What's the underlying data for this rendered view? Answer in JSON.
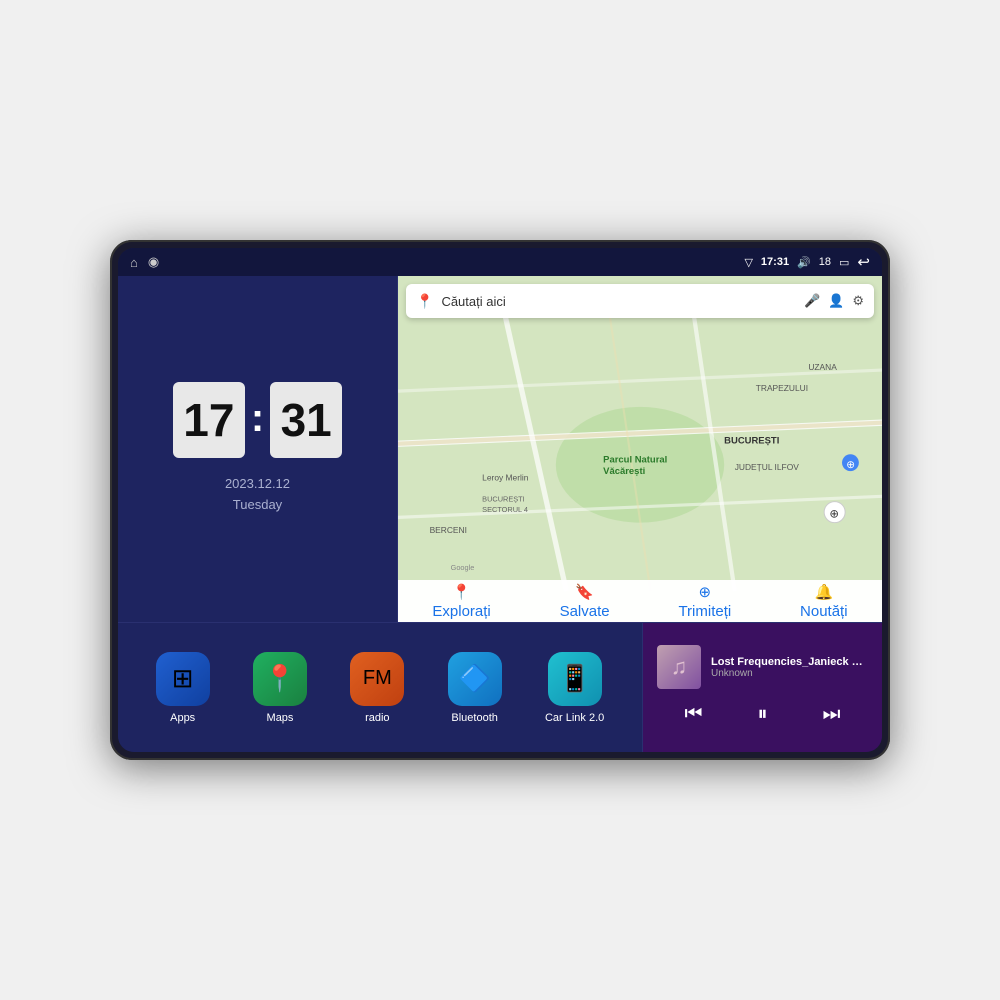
{
  "device": {
    "status_bar": {
      "signal_icon": "▽",
      "time": "17:31",
      "volume_icon": "🔊",
      "battery_level": "18",
      "battery_icon": "▭",
      "back_icon": "↩",
      "home_icon": "⌂",
      "nav_icon": "◉"
    },
    "clock": {
      "hours": "17",
      "minutes": "31",
      "date": "2023.12.12",
      "day": "Tuesday"
    },
    "map": {
      "search_placeholder": "Căutați aici",
      "nav_items": [
        {
          "label": "Explorați",
          "icon": "📍"
        },
        {
          "label": "Salvate",
          "icon": "🔖"
        },
        {
          "label": "Trimiteți",
          "icon": "⊕"
        },
        {
          "label": "Noutăți",
          "icon": "🔔"
        }
      ],
      "location_labels": [
        "Parcul Natural Văcărești",
        "Leroy Merlin",
        "BUCUREȘTI SECTORUL 4",
        "BUCUREȘTI",
        "JUDEȚUL ILFOV",
        "TRAPEZULUI",
        "BERCENI",
        "Google",
        "UZANA"
      ]
    },
    "apps": [
      {
        "label": "Apps",
        "icon": "⊞",
        "bg_class": "icon-apps"
      },
      {
        "label": "Maps",
        "icon": "📍",
        "bg_class": "icon-maps"
      },
      {
        "label": "radio",
        "icon": "📻",
        "bg_class": "icon-radio"
      },
      {
        "label": "Bluetooth",
        "icon": "🦷",
        "bg_class": "icon-bluetooth"
      },
      {
        "label": "Car Link 2.0",
        "icon": "📱",
        "bg_class": "icon-carlink"
      }
    ],
    "music": {
      "title": "Lost Frequencies_Janieck Devy-...",
      "artist": "Unknown",
      "prev_icon": "⏮",
      "play_icon": "⏸",
      "next_icon": "⏭"
    }
  }
}
